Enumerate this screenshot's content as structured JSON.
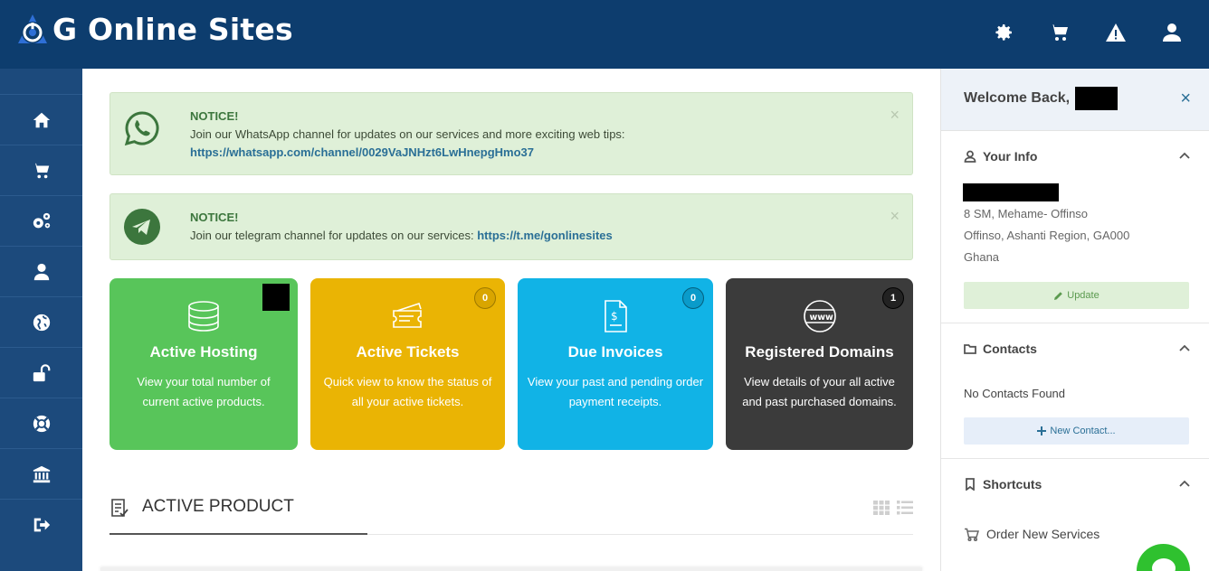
{
  "header": {
    "brand_text": "G Online Sites",
    "icons": [
      "gear-icon",
      "cart-icon",
      "warning-icon",
      "user-icon"
    ]
  },
  "sidebar": {
    "items": [
      {
        "icon": "home-icon"
      },
      {
        "icon": "cart-icon"
      },
      {
        "icon": "gears-icon"
      },
      {
        "icon": "user-icon"
      },
      {
        "icon": "globe-icon"
      },
      {
        "icon": "unlock-icon"
      },
      {
        "icon": "lifering-icon"
      },
      {
        "icon": "bank-icon"
      },
      {
        "icon": "logout-icon"
      }
    ]
  },
  "notices": [
    {
      "title": "NOTICE!",
      "message": "Join our WhatsApp channel for updates on our services and more exciting web tips:",
      "link": "https://whatsapp.com/channel/0029VaJNHzt6LwHnepgHmo37",
      "close": "×"
    },
    {
      "title": "NOTICE!",
      "message": "Join our telegram channel for updates on our services: ",
      "link": "https://t.me/gonlinesites",
      "close": "×"
    }
  ],
  "tiles": [
    {
      "title": "Active Hosting",
      "desc": "View your total number of current active products.",
      "badge": "",
      "color": "#58c55a"
    },
    {
      "title": "Active Tickets",
      "desc": "Quick view to know the  status of all your active tickets.",
      "badge": "0",
      "color": "#eab404"
    },
    {
      "title": "Due Invoices",
      "desc": "View your past and pending order payment receipts.",
      "badge": "0",
      "color": "#11b3e6"
    },
    {
      "title": "Registered Domains",
      "desc": "View details of your all active and past purchased domains.",
      "badge": "1",
      "color": "#3b3b3b"
    }
  ],
  "section": {
    "title": "ACTIVE PRODUCT"
  },
  "right_panel": {
    "welcome": "Welcome Back,",
    "close": "×",
    "your_info": {
      "title": "Your Info",
      "address_line1": "8 SM, Mehame- Offinso",
      "address_line2": "Offinso, Ashanti Region, GA000",
      "country": "Ghana",
      "update_label": "Update"
    },
    "contacts": {
      "title": "Contacts",
      "empty_text": "No Contacts Found",
      "new_label": "New Contact..."
    },
    "shortcuts": {
      "title": "Shortcuts",
      "item": "Order New Services"
    }
  }
}
